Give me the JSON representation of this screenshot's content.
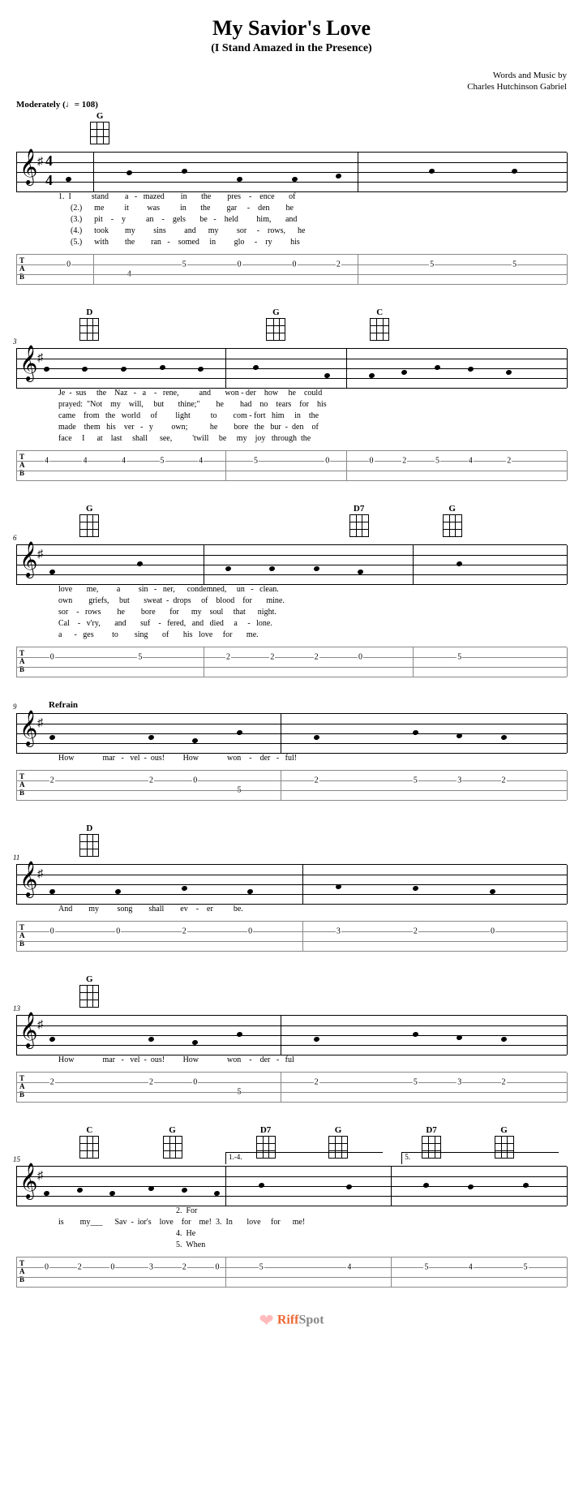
{
  "title": "My Savior's Love",
  "subtitle": "(I Stand Amazed in the Presence)",
  "credits_line1": "Words and Music by",
  "credits_line2": "Charles Hutchinson Gabriel",
  "tempo": "Moderately  (♩= 108)",
  "refrain_label": "Refrain",
  "chords": {
    "G": "G",
    "D": "D",
    "C": "C",
    "D7": "D7"
  },
  "systems": [
    {
      "measure_start": null,
      "chords": [
        {
          "name": "G",
          "pos": 8
        }
      ],
      "lyrics": [
        "1.  I          stand        a   -   mazed        in       the        pres    -    ence       of",
        "      (2.)      me          it         was          in       the        gar     -    den        he",
        "      (3.)      pit    -    y          an    -    gels       be   -    held         him,       and",
        "      (4.)      took        my         sins         and      my         sor     -    rows,      he",
        "      (5.)      with        the        ran   -    somed     in         glo     -    ry         his"
      ],
      "tab": [
        {
          "s": 2,
          "p": 9,
          "f": "0"
        },
        {
          "s": 3,
          "p": 20,
          "f": "4"
        },
        {
          "s": 2,
          "p": 30,
          "f": "5"
        },
        {
          "s": 2,
          "p": 40,
          "f": "0"
        },
        {
          "s": 2,
          "p": 50,
          "f": "0"
        },
        {
          "s": 2,
          "p": 58,
          "f": "2"
        },
        {
          "s": 2,
          "p": 75,
          "f": "5"
        },
        {
          "s": 2,
          "p": 90,
          "f": "5"
        }
      ],
      "barlines_staff": [
        0,
        14,
        62,
        100
      ],
      "barlines_tab": [
        0,
        14,
        62,
        100
      ]
    },
    {
      "measure_start": 3,
      "chords": [
        {
          "name": "D",
          "pos": 6
        },
        {
          "name": "G",
          "pos": 42
        },
        {
          "name": "C",
          "pos": 62
        }
      ],
      "lyrics": [
        "Je  -  sus     the    Naz   -   a    -   rene,          and       won - der    how     he    could",
        "prayed:  \"Not    my    will,     but       thine;\"        he        had    no    tears    for    his",
        "came    from   the   world     of         light          to        com - fort   him     in    the",
        "made    them   his    ver   -   y         own;           he        bore   the   bur  -  den    of",
        "face     I      at    last     shall      see,          'twill     be     my    joy   through  the"
      ],
      "tab": [
        {
          "s": 2,
          "p": 5,
          "f": "4"
        },
        {
          "s": 2,
          "p": 12,
          "f": "4"
        },
        {
          "s": 2,
          "p": 19,
          "f": "4"
        },
        {
          "s": 2,
          "p": 26,
          "f": "5"
        },
        {
          "s": 2,
          "p": 33,
          "f": "4"
        },
        {
          "s": 2,
          "p": 43,
          "f": "5"
        },
        {
          "s": 2,
          "p": 56,
          "f": "0"
        },
        {
          "s": 2,
          "p": 64,
          "f": "0"
        },
        {
          "s": 2,
          "p": 70,
          "f": "2"
        },
        {
          "s": 2,
          "p": 76,
          "f": "5"
        },
        {
          "s": 2,
          "p": 82,
          "f": "4"
        },
        {
          "s": 2,
          "p": 89,
          "f": "2"
        }
      ],
      "barlines_staff": [
        0,
        38,
        60,
        100
      ],
      "barlines_tab": [
        0,
        38,
        60,
        100
      ]
    },
    {
      "measure_start": 6,
      "chords": [
        {
          "name": "G",
          "pos": 6
        },
        {
          "name": "D7",
          "pos": 58
        },
        {
          "name": "G",
          "pos": 76
        }
      ],
      "lyrics": [
        "love       me,         a         sin   -   ner,      condemned,     un   -   clean.",
        "own        griefs,     but       sweat  -  drops     of    blood    for       mine.",
        "sor    -   rows        he        bore       for      my    soul     that      night.",
        "Cal    -   v'ry,       and       suf    -   fered,   and   died     a     -   lone.",
        "a      -   ges         to        sing       of       his   love     for       me."
      ],
      "tab": [
        {
          "s": 2,
          "p": 6,
          "f": "0"
        },
        {
          "s": 2,
          "p": 22,
          "f": "5"
        },
        {
          "s": 2,
          "p": 38,
          "f": "2"
        },
        {
          "s": 2,
          "p": 46,
          "f": "2"
        },
        {
          "s": 2,
          "p": 54,
          "f": "2"
        },
        {
          "s": 2,
          "p": 62,
          "f": "0"
        },
        {
          "s": 2,
          "p": 80,
          "f": "5"
        }
      ],
      "barlines_staff": [
        0,
        34,
        72,
        100
      ],
      "barlines_tab": [
        0,
        34,
        72,
        100
      ]
    },
    {
      "measure_start": 9,
      "refrain": true,
      "chords": [],
      "lyrics": [
        "How              mar   -   vel  -  ous!         How              won    -    der   -   ful!"
      ],
      "tab": [
        {
          "s": 2,
          "p": 6,
          "f": "2"
        },
        {
          "s": 2,
          "p": 24,
          "f": "2"
        },
        {
          "s": 2,
          "p": 32,
          "f": "0"
        },
        {
          "s": 3,
          "p": 40,
          "f": "5"
        },
        {
          "s": 2,
          "p": 54,
          "f": "2"
        },
        {
          "s": 2,
          "p": 72,
          "f": "5"
        },
        {
          "s": 2,
          "p": 80,
          "f": "3"
        },
        {
          "s": 2,
          "p": 88,
          "f": "2"
        }
      ],
      "barlines_staff": [
        0,
        48,
        100
      ],
      "barlines_tab": [
        0,
        48,
        100
      ]
    },
    {
      "measure_start": 11,
      "chords": [
        {
          "name": "D",
          "pos": 6
        }
      ],
      "lyrics": [
        "And        my         song        shall        ev    -    er          be."
      ],
      "tab": [
        {
          "s": 2,
          "p": 6,
          "f": "0"
        },
        {
          "s": 2,
          "p": 18,
          "f": "0"
        },
        {
          "s": 2,
          "p": 30,
          "f": "2"
        },
        {
          "s": 2,
          "p": 42,
          "f": "0"
        },
        {
          "s": 2,
          "p": 58,
          "f": "3"
        },
        {
          "s": 2,
          "p": 72,
          "f": "2"
        },
        {
          "s": 2,
          "p": 86,
          "f": "0"
        }
      ],
      "barlines_staff": [
        0,
        52,
        100
      ],
      "barlines_tab": [
        0,
        52,
        100
      ]
    },
    {
      "measure_start": 13,
      "chords": [
        {
          "name": "G",
          "pos": 6
        }
      ],
      "lyrics": [
        "How              mar   -   vel  -  ous!         How              won    -    der   -   ful"
      ],
      "tab": [
        {
          "s": 2,
          "p": 6,
          "f": "2"
        },
        {
          "s": 2,
          "p": 24,
          "f": "2"
        },
        {
          "s": 2,
          "p": 32,
          "f": "0"
        },
        {
          "s": 3,
          "p": 40,
          "f": "5"
        },
        {
          "s": 2,
          "p": 54,
          "f": "2"
        },
        {
          "s": 2,
          "p": 72,
          "f": "5"
        },
        {
          "s": 2,
          "p": 80,
          "f": "3"
        },
        {
          "s": 2,
          "p": 88,
          "f": "2"
        }
      ],
      "barlines_staff": [
        0,
        48,
        100
      ],
      "barlines_tab": [
        0,
        48,
        100
      ]
    },
    {
      "measure_start": 15,
      "chords": [
        {
          "name": "C",
          "pos": 6
        },
        {
          "name": "G",
          "pos": 22
        },
        {
          "name": "D7",
          "pos": 40
        },
        {
          "name": "G",
          "pos": 54
        },
        {
          "name": "D7",
          "pos": 72
        },
        {
          "name": "G",
          "pos": 86
        }
      ],
      "endings": [
        {
          "label": "1.-4.",
          "pos": 38,
          "width": 28
        },
        {
          "label": "5.",
          "pos": 70,
          "width": 28
        }
      ],
      "lyrics": [
        "                                                          2.  For",
        "is        my___      Sav  -  ior's    love    for    me!  3.  In       love     for      me!",
        "                                                          4.  He",
        "                                                          5.  When"
      ],
      "tab": [
        {
          "s": 2,
          "p": 5,
          "f": "0"
        },
        {
          "s": 2,
          "p": 11,
          "f": "2"
        },
        {
          "s": 2,
          "p": 17,
          "f": "0"
        },
        {
          "s": 2,
          "p": 24,
          "f": "3"
        },
        {
          "s": 2,
          "p": 30,
          "f": "2"
        },
        {
          "s": 2,
          "p": 36,
          "f": "0"
        },
        {
          "s": 2,
          "p": 44,
          "f": "5"
        },
        {
          "s": 2,
          "p": 60,
          "f": "4"
        },
        {
          "s": 2,
          "p": 74,
          "f": "5"
        },
        {
          "s": 2,
          "p": 82,
          "f": "4"
        },
        {
          "s": 2,
          "p": 92,
          "f": "5"
        }
      ],
      "barlines_staff": [
        0,
        38,
        68,
        100
      ],
      "barlines_tab": [
        0,
        38,
        68,
        100
      ]
    }
  ],
  "footer": {
    "brand_r": "Riff",
    "brand_s": "Spot"
  }
}
